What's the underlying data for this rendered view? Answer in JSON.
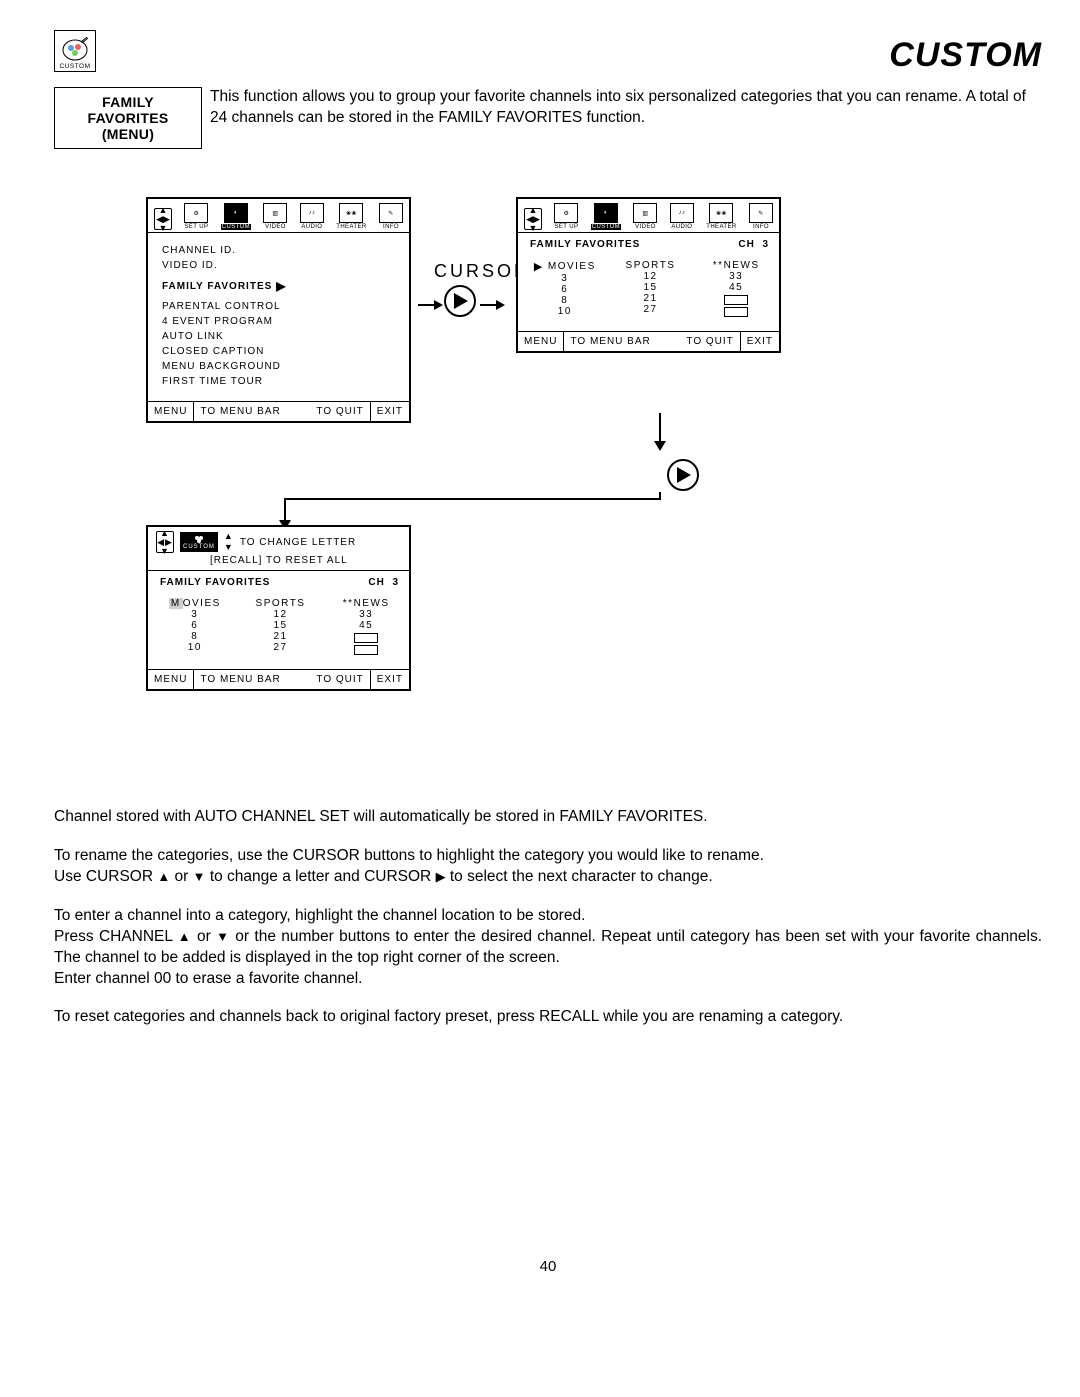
{
  "header": {
    "logo_caption": "CUSTOM",
    "title": "CUSTOM"
  },
  "intro": {
    "label_line1": "FAMILY FAVORITES",
    "label_line2": "(MENU)",
    "text": "This function allows you to group your favorite channels into six personalized categories that you can rename. A total of 24 channels can be stored in the FAMILY FAVORITES function."
  },
  "tabs": [
    "SET UP",
    "CUSTOM",
    "VIDEO",
    "AUDIO",
    "THEATER",
    "INFO"
  ],
  "panel1": {
    "items": [
      "CHANNEL ID.",
      "VIDEO ID.",
      "FAMILY FAVORITES",
      "PARENTAL CONTROL",
      "4 EVENT PROGRAM",
      "AUTO LINK",
      "CLOSED CAPTION",
      "MENU BACKGROUND",
      "FIRST TIME TOUR"
    ],
    "selected_index": 2
  },
  "cursor_label": "CURSOR",
  "fav": {
    "title": "FAMILY FAVORITES",
    "ch_label": "CH",
    "ch_value": "3",
    "cols": [
      {
        "head": "MOVIES",
        "rows": [
          "3",
          "6",
          "8",
          "10"
        ],
        "arrow": true
      },
      {
        "head": "SPORTS",
        "rows": [
          "12",
          "15",
          "21",
          "27"
        ]
      },
      {
        "head": "**NEWS",
        "rows": [
          "33",
          "45",
          "",
          ""
        ],
        "slots_after": 2
      }
    ]
  },
  "panel3": {
    "top_line": "TO CHANGE LETTER",
    "reset_line": "[RECALL] TO RESET ALL",
    "highlight_head": "MOVIES"
  },
  "footer": {
    "menu": "MENU",
    "menubar": "TO MENU BAR",
    "toquit": "TO QUIT",
    "exit": "EXIT"
  },
  "body": {
    "p1": "Channel stored with AUTO CHANNEL SET will automatically be stored in FAMILY FAVORITES.",
    "p2a": "To rename the categories, use the CURSOR buttons to highlight the category you would like to rename.",
    "p2b_pre": "Use CURSOR ",
    "p2b_mid": " or ",
    "p2b_post1": " to change a letter and CURSOR ",
    "p2b_post2": " to select the next character to change.",
    "p3a": "To enter a channel into a category, highlight the channel location to be stored.",
    "p3b_pre": "Press CHANNEL ",
    "p3b_mid": " or ",
    "p3b_post": " or the number buttons to enter the desired channel.  Repeat until category has been set with your favorite channels.  The channel to be added is displayed in the top right corner of the screen.",
    "p3c": "Enter channel 00 to erase a favorite channel.",
    "p4": "To reset categories and channels back to original factory preset, press RECALL while you are renaming a category."
  },
  "page_number": "40"
}
